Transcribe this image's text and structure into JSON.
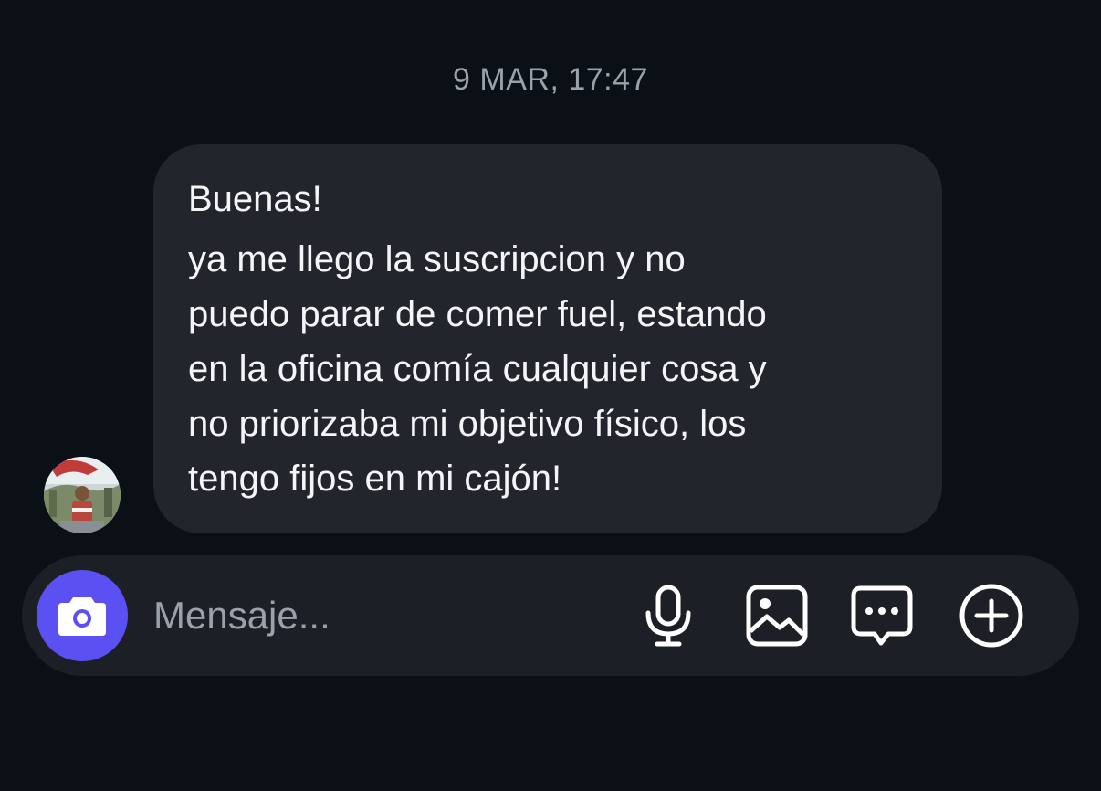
{
  "conversation": {
    "timestamp": "9 MAR, 17:47",
    "message": {
      "lines": [
        "Buenas!",
        "ya me llego la suscripcion y no",
        "puedo parar de comer fuel, estando",
        "en la oficina comía cualquier cosa y",
        "no priorizaba mi objetivo físico, los",
        "tengo fijos en mi cajón!"
      ]
    },
    "sender_avatar": "avatar"
  },
  "composer": {
    "placeholder": "Mensaje...",
    "value": "",
    "camera_icon": "camera-icon",
    "actions": [
      {
        "icon": "microphone-icon"
      },
      {
        "icon": "image-icon"
      },
      {
        "icon": "chat-bubble-icon"
      },
      {
        "icon": "plus-circle-icon"
      }
    ]
  },
  "colors": {
    "background": "#0b0f16",
    "bubble": "#22252c",
    "composer": "#1c1f25",
    "accent": "#5b51f2",
    "muted_text": "#9aa1ab",
    "text": "#f4f5f7"
  }
}
